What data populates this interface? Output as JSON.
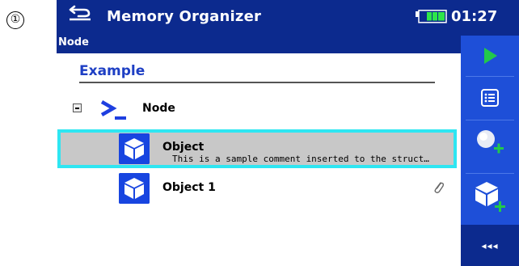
{
  "step_marker": "①",
  "header": {
    "title": "Memory Organizer",
    "time": "01:27",
    "back_icon": "back-arrow-icon",
    "battery_icon": "battery-icon"
  },
  "breadcrumb": "Node",
  "tree": {
    "root_label": "Example",
    "node": {
      "label": "Node",
      "icon": "node-prompt-icon",
      "collapse_icon": "collapse-minus-icon"
    },
    "objects": [
      {
        "name": "Object",
        "comment": "This is a sample comment inserted to the struct…",
        "icon": "object-cube-icon",
        "selected": true
      },
      {
        "name": "Object 1",
        "comment": "",
        "icon": "object-cube-icon",
        "attachment_icon": "paperclip-icon",
        "selected": false
      }
    ]
  },
  "sidebar": {
    "buttons": [
      {
        "name": "start-test-button",
        "icon": "play-icon"
      },
      {
        "name": "view-results-button",
        "icon": "list-icon"
      },
      {
        "name": "add-measurement-button",
        "icon": "add-measurement-icon"
      },
      {
        "name": "add-structure-object-button",
        "icon": "add-object-icon"
      }
    ],
    "more_label": "◂◂◂"
  },
  "colors": {
    "header_bg": "#0c2a8e",
    "sidebar_bg": "#1e4fd8",
    "accent_green": "#22c94a",
    "selection_border": "#2ee6f2",
    "selection_bg": "#c8c8c8",
    "example_text": "#1e3fc4"
  }
}
